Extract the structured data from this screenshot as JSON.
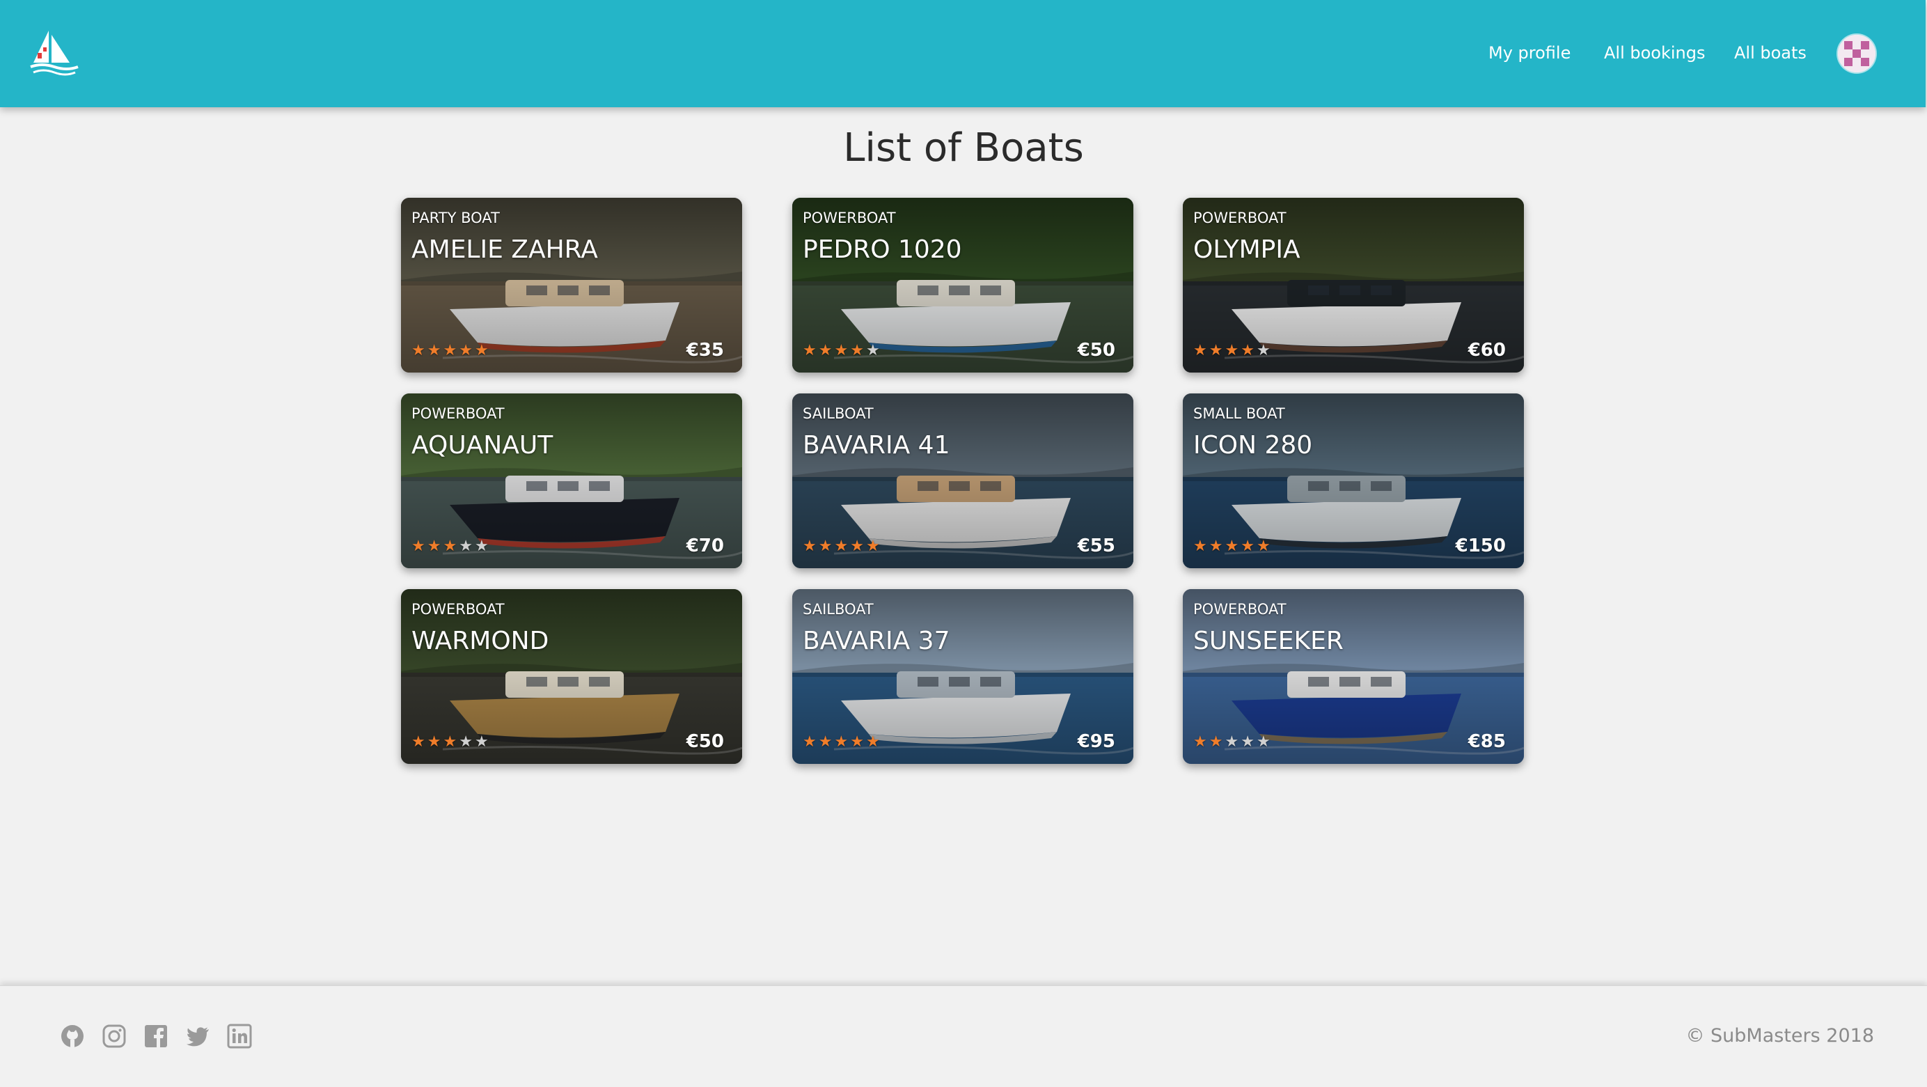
{
  "header": {
    "logo_icon": "sailboat-logo-icon",
    "nav": [
      {
        "label": "My profile"
      },
      {
        "label": "All bookings"
      },
      {
        "label": "All boats"
      }
    ],
    "avatar_icon": "user-avatar-icon"
  },
  "page": {
    "title": "List of Boats"
  },
  "colors": {
    "brand": "#24b5c8",
    "star_on": "#f07d2a",
    "star_off": "#d0d0d0"
  },
  "boats": [
    {
      "category": "PARTY BOAT",
      "name": "AMELIE ZAHRA",
      "rating": 5,
      "price": "€35"
    },
    {
      "category": "POWERBOAT",
      "name": "PEDRO 1020",
      "rating": 4,
      "price": "€50"
    },
    {
      "category": "POWERBOAT",
      "name": "OLYMPIA",
      "rating": 4,
      "price": "€60"
    },
    {
      "category": "POWERBOAT",
      "name": "AQUANAUT",
      "rating": 3,
      "price": "€70"
    },
    {
      "category": "SAILBOAT",
      "name": "BAVARIA 41",
      "rating": 5,
      "price": "€55"
    },
    {
      "category": "SMALL BOAT",
      "name": "ICON 280",
      "rating": 5,
      "price": "€150"
    },
    {
      "category": "POWERBOAT",
      "name": "WARMOND",
      "rating": 3,
      "price": "€50"
    },
    {
      "category": "SAILBOAT",
      "name": "BAVARIA 37",
      "rating": 5,
      "price": "€95"
    },
    {
      "category": "POWERBOAT",
      "name": "SUNSEEKER",
      "rating": 2,
      "price": "€85"
    }
  ],
  "footer": {
    "social_icons": [
      "github-icon",
      "instagram-icon",
      "facebook-icon",
      "twitter-icon",
      "linkedin-icon"
    ],
    "copyright": "© SubMasters 2018"
  }
}
